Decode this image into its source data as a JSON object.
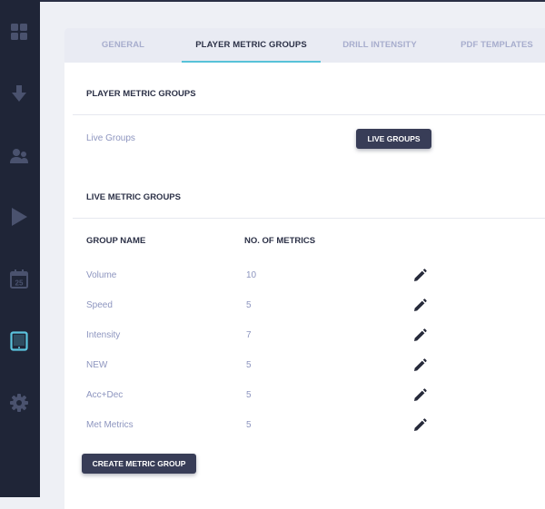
{
  "sidebar": {
    "items": [
      {
        "icon": "grid-icon"
      },
      {
        "icon": "download-icon"
      },
      {
        "icon": "users-icon"
      },
      {
        "icon": "play-icon"
      },
      {
        "icon": "calendar-icon",
        "text": "25"
      },
      {
        "icon": "tablet-icon",
        "active": true
      },
      {
        "icon": "gear-icon"
      }
    ]
  },
  "tabs": [
    {
      "label": "GENERAL",
      "active": false
    },
    {
      "label": "PLAYER METRIC GROUPS",
      "active": true
    },
    {
      "label": "DRILL INTENSITY",
      "active": false
    },
    {
      "label": "PDF TEMPLATES",
      "active": false
    }
  ],
  "player_metric_groups": {
    "title": "PLAYER METRIC GROUPS",
    "live_groups_label": "Live Groups",
    "live_groups_button": "LIVE GROUPS"
  },
  "live_metric_groups": {
    "title": "LIVE METRIC GROUPS",
    "columns": {
      "name": "GROUP NAME",
      "count": "NO. OF METRICS"
    },
    "rows": [
      {
        "name": "Volume",
        "count": "10"
      },
      {
        "name": "Speed",
        "count": "5"
      },
      {
        "name": "Intensity",
        "count": "7"
      },
      {
        "name": "NEW",
        "count": "5"
      },
      {
        "name": "Acc+Dec",
        "count": "5"
      },
      {
        "name": "Met Metrics",
        "count": "5"
      }
    ],
    "create_button": "CREATE METRIC GROUP"
  },
  "colors": {
    "sidebar_bg": "#1f2537",
    "sidebar_icon": "#4a526e",
    "sidebar_active_icon": "#5bc3dd",
    "accent": "#57c2d8",
    "button_bg": "#383d57"
  }
}
